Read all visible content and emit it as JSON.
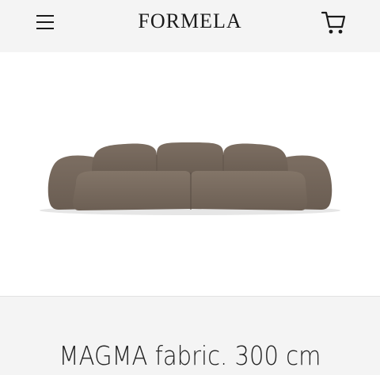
{
  "header": {
    "brand": "FORMELA",
    "menu_icon": "hamburger-menu-icon",
    "cart_icon": "shopping-cart-icon"
  },
  "product": {
    "image_subject": "sofa",
    "title": "MAGMA fabric. 300 cm"
  },
  "colors": {
    "background": "#f4f4f4",
    "image_background": "#ffffff",
    "sofa": "#76685c",
    "text": "#1a1a1a"
  }
}
